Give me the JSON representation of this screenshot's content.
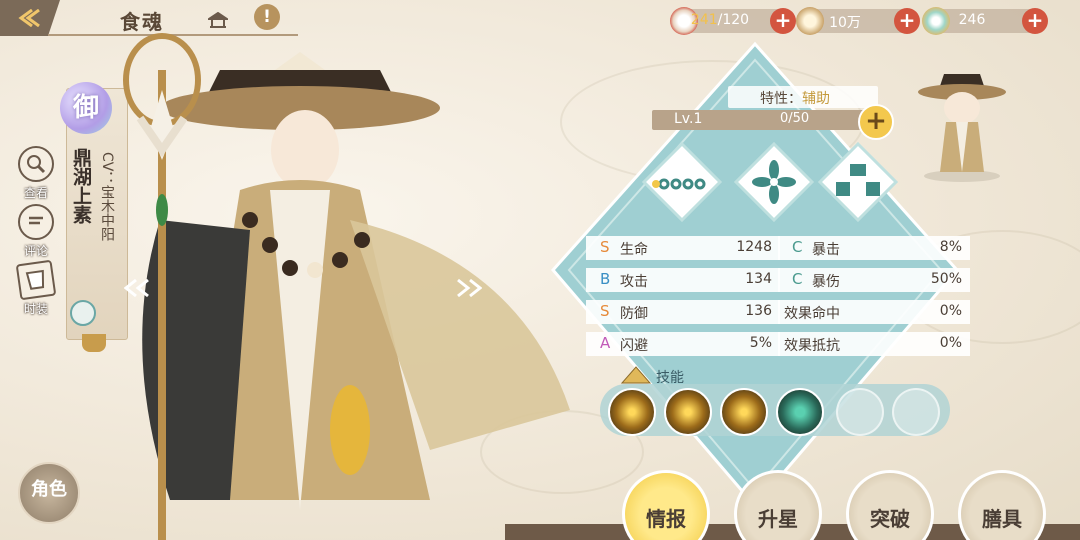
{
  "header": {
    "title": "食魂"
  },
  "resources": [
    {
      "name": "stamina",
      "current": "241",
      "max": "/120",
      "icon": "bowl-icon"
    },
    {
      "name": "coins",
      "value": "10万",
      "icon": "scroll-icon"
    },
    {
      "name": "jade",
      "value": "246",
      "icon": "jade-icon"
    }
  ],
  "side_menu": [
    {
      "label": "查看",
      "icon": "magnifier-icon"
    },
    {
      "label": "评论",
      "icon": "comment-icon"
    },
    {
      "label": "时装",
      "icon": "outfit-icon"
    }
  ],
  "character": {
    "rarity": "御",
    "name": "鼎湖上素",
    "cv": "CV：宝木中阳",
    "trait_label": "特性：",
    "trait_value": "辅助",
    "level": "Lv.1",
    "exp": "0/50"
  },
  "role_button": "角色",
  "stats_left": [
    {
      "grade": "S",
      "name": "生命",
      "value": "1248"
    },
    {
      "grade": "B",
      "name": "攻击",
      "value": "134"
    },
    {
      "grade": "S",
      "name": "防御",
      "value": "136"
    },
    {
      "grade": "A",
      "name": "闪避",
      "value": "5%"
    }
  ],
  "stats_right": [
    {
      "grade": "C",
      "name": "暴击",
      "value": "8%"
    },
    {
      "grade": "C",
      "name": "暴伤",
      "value": "50%"
    },
    {
      "grade": "",
      "name": "效果命中",
      "value": "0%"
    },
    {
      "grade": "",
      "name": "效果抵抗",
      "value": "0%"
    }
  ],
  "skills_label": "技能",
  "tabs": [
    {
      "label": "情报",
      "active": true
    },
    {
      "label": "升星",
      "active": false
    },
    {
      "label": "突破",
      "active": false
    },
    {
      "label": "膳具",
      "active": false
    }
  ]
}
